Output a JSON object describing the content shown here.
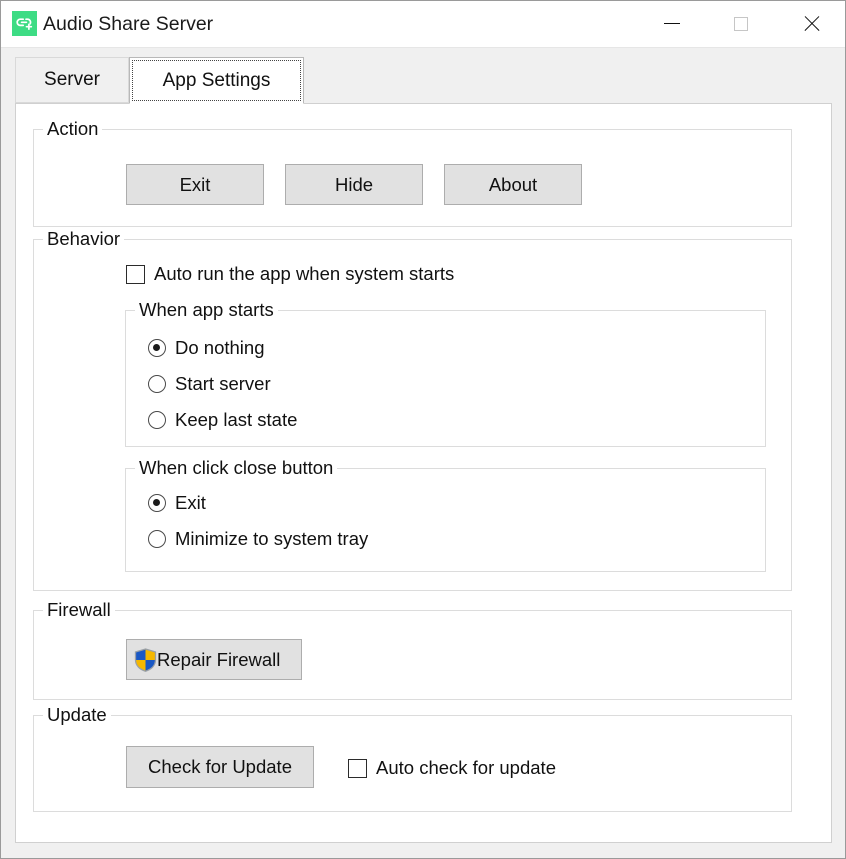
{
  "window": {
    "title": "Audio Share Server",
    "icon": "link-plus-icon",
    "accent_green": "#3ddc84",
    "controls": {
      "minimize": "minimize-icon",
      "maximize": "maximize-icon",
      "close": "close-icon"
    }
  },
  "tabs": [
    {
      "label": "Server",
      "selected": false
    },
    {
      "label": "App Settings",
      "selected": true
    }
  ],
  "groups": {
    "action": {
      "title": "Action",
      "buttons": [
        {
          "label": "Exit"
        },
        {
          "label": "Hide"
        },
        {
          "label": "About"
        }
      ]
    },
    "behavior": {
      "title": "Behavior",
      "autorun": {
        "label": "Auto run the app when system starts",
        "checked": false
      },
      "when_app_starts": {
        "title": "When app starts",
        "options": [
          {
            "label": "Do nothing",
            "selected": true
          },
          {
            "label": "Start server",
            "selected": false
          },
          {
            "label": "Keep last state",
            "selected": false
          }
        ]
      },
      "when_click_close": {
        "title": "When click close button",
        "options": [
          {
            "label": "Exit",
            "selected": true
          },
          {
            "label": "Minimize to system tray",
            "selected": false
          }
        ]
      }
    },
    "firewall": {
      "title": "Firewall",
      "repair_button": {
        "label": "Repair Firewall",
        "icon": "uac-shield-icon",
        "shield_blue": "#1a58c4",
        "shield_yellow": "#f5b800"
      }
    },
    "update": {
      "title": "Update",
      "check_button": {
        "label": "Check for Update"
      },
      "auto_check": {
        "label": "Auto check for update",
        "checked": false
      }
    }
  }
}
